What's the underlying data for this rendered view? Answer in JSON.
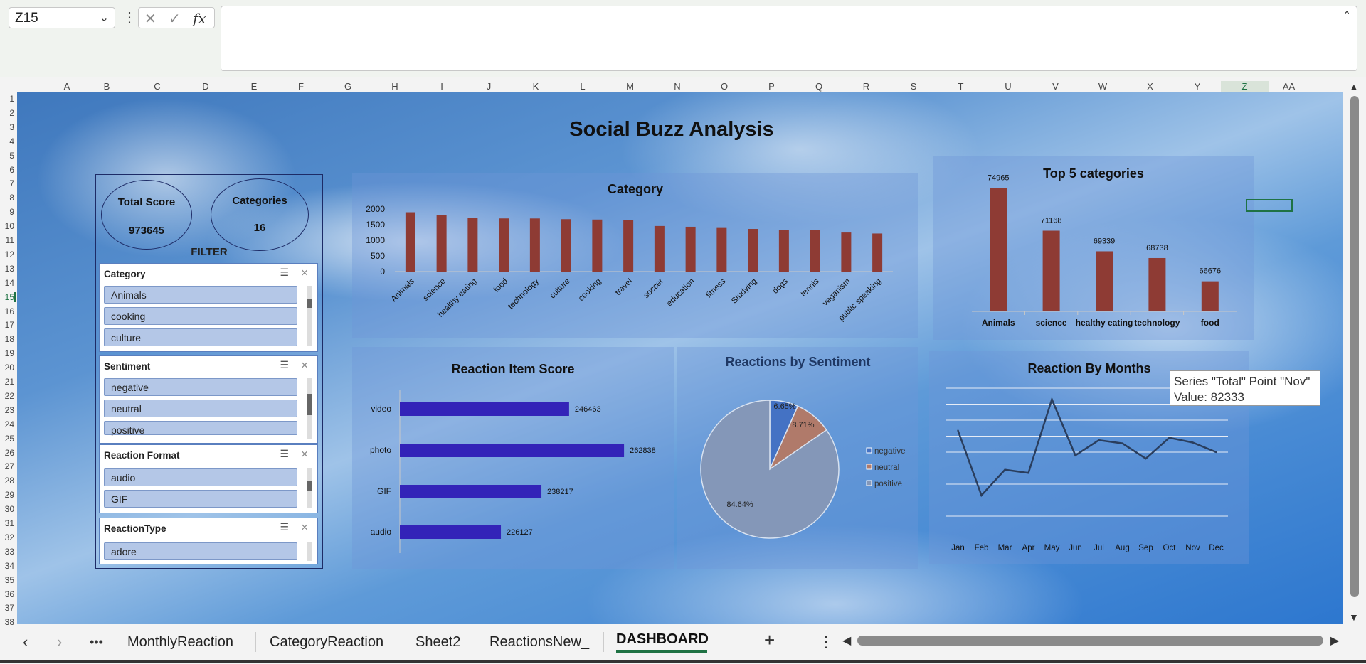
{
  "formula_bar": {
    "name_box": "Z15",
    "formula": ""
  },
  "columns": [
    "A",
    "B",
    "C",
    "D",
    "E",
    "F",
    "G",
    "H",
    "I",
    "J",
    "K",
    "L",
    "M",
    "N",
    "O",
    "P",
    "Q",
    "R",
    "S",
    "T",
    "U",
    "V",
    "W",
    "X",
    "Y",
    "Z",
    "AA"
  ],
  "rows": [
    "1",
    "2",
    "3",
    "4",
    "5",
    "6",
    "7",
    "8",
    "9",
    "10",
    "11",
    "12",
    "13",
    "14",
    "15",
    "16",
    "17",
    "18",
    "19",
    "20",
    "21",
    "22",
    "23",
    "24",
    "25",
    "26",
    "27",
    "28",
    "29",
    "30",
    "31",
    "32",
    "33",
    "34",
    "35",
    "36",
    "37",
    "38"
  ],
  "dashboard": {
    "title": "Social Buzz Analysis",
    "kpis": {
      "total_score_label": "Total Score",
      "total_score_value": "973645",
      "categories_label": "Categories",
      "categories_value": "16"
    },
    "filter_label": "FILTER",
    "slicers": [
      {
        "title": "Category",
        "items": [
          "Animals",
          "cooking",
          "culture"
        ]
      },
      {
        "title": "Sentiment",
        "items": [
          "negative",
          "neutral",
          "positive"
        ]
      },
      {
        "title": "Reaction Format",
        "items": [
          "audio",
          "GIF"
        ]
      },
      {
        "title": "ReactionType",
        "items": [
          "adore"
        ]
      }
    ],
    "tooltip": {
      "line1": "Series \"Total\" Point \"Nov\"",
      "line2": "Value: 82333"
    }
  },
  "sheet_tabs": [
    "MonthlyReaction",
    "CategoryReaction",
    "Sheet2",
    "ReactionsNew_",
    "DASHBOARD"
  ],
  "active_tab": "DASHBOARD",
  "colors": {
    "bar_red": "#8e3b34",
    "bar_blue": "#3323b8",
    "line": "#2a3e5e",
    "excel_green": "#1f7244"
  },
  "chart_data": [
    {
      "type": "bar",
      "title": "Category",
      "categories": [
        "Animals",
        "science",
        "healthy eating",
        "food",
        "technology",
        "culture",
        "cooking",
        "travel",
        "soccer",
        "education",
        "fitness",
        "Studying",
        "dogs",
        "tennis",
        "veganism",
        "public speaking"
      ],
      "values": [
        1897,
        1796,
        1717,
        1699,
        1698,
        1676,
        1664,
        1647,
        1457,
        1433,
        1395,
        1363,
        1338,
        1328,
        1248,
        1217
      ],
      "yticks": [
        "0",
        "500",
        "1000",
        "1500",
        "2000"
      ],
      "ylim": [
        0,
        2000
      ]
    },
    {
      "type": "bar",
      "title": "Top 5 categories",
      "categories": [
        "Animals",
        "science",
        "healthy eating",
        "technology",
        "food"
      ],
      "values": [
        74965,
        71168,
        69339,
        68738,
        66676
      ],
      "labels": [
        "74965",
        "71168",
        "69339",
        "68738",
        "66676"
      ],
      "ylim": [
        64000,
        76000
      ]
    },
    {
      "type": "bar",
      "orientation": "horizontal",
      "title": "Reaction Item Score",
      "categories": [
        "video",
        "photo",
        "GIF",
        "audio"
      ],
      "values": [
        246463,
        262838,
        238217,
        226127
      ],
      "labels": [
        "246463",
        "262838",
        "238217",
        "226127"
      ],
      "xlim": [
        196000,
        266000
      ]
    },
    {
      "type": "pie",
      "title": "Reactions by Sentiment",
      "categories": [
        "negative",
        "neutral",
        "positive"
      ],
      "values": [
        6.65,
        8.71,
        84.64
      ],
      "labels": [
        "6.65%",
        "8.71%",
        "84.64%"
      ],
      "colors": [
        "#4472c4",
        "#b07a6a",
        "#8497b8"
      ],
      "legend": "right"
    },
    {
      "type": "line",
      "title": "Reaction By Months",
      "categories": [
        "Jan",
        "Feb",
        "Mar",
        "Apr",
        "May",
        "Jun",
        "Jul",
        "Aug",
        "Sep",
        "Oct",
        "Nov",
        "Dec"
      ],
      "values": [
        82700,
        74600,
        77800,
        77400,
        86600,
        79600,
        81500,
        81100,
        79200,
        81800,
        81200,
        80000
      ],
      "ylim": [
        72000,
        88000
      ],
      "grid": true
    }
  ]
}
